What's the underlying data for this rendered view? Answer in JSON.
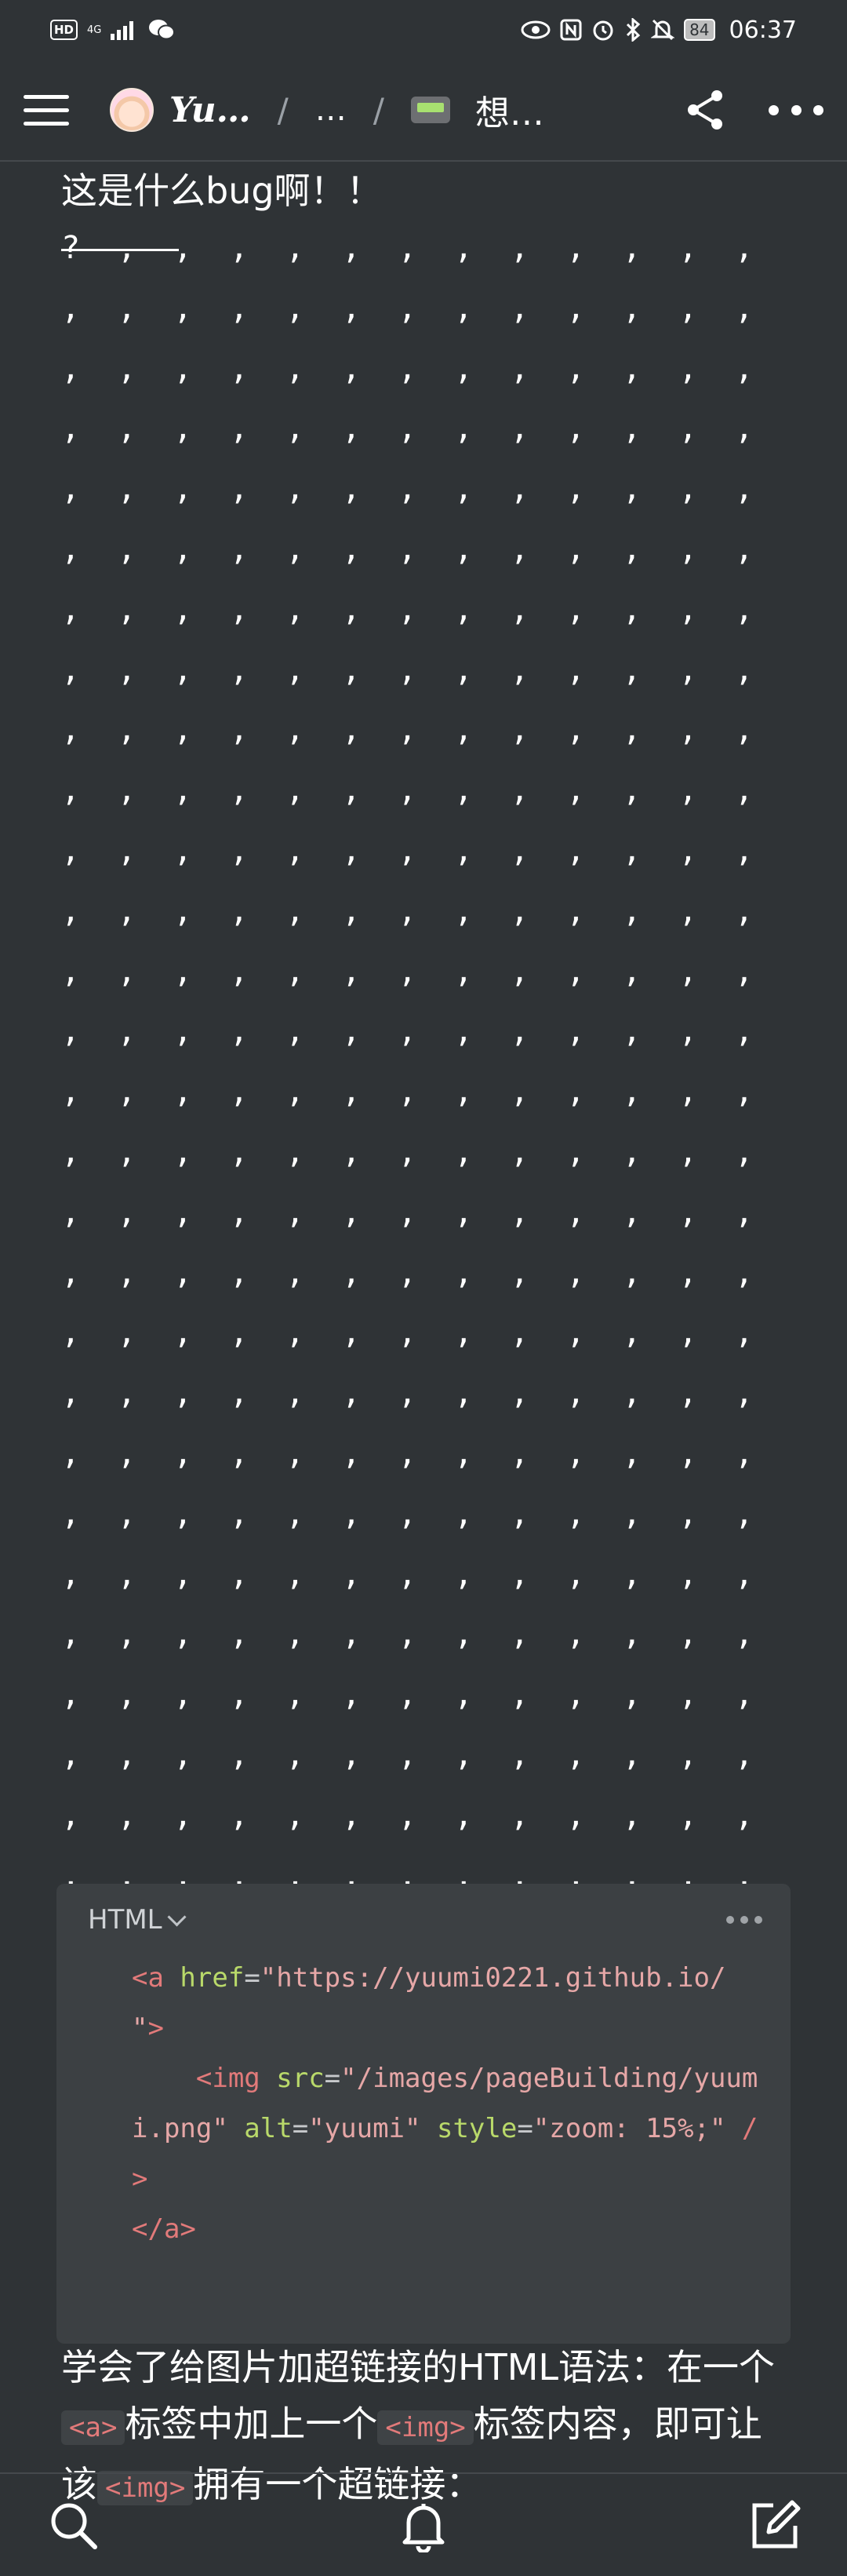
{
  "status_bar": {
    "hd_label": "HD",
    "network_label": "4G",
    "battery": "84",
    "time": "06:37",
    "icons": [
      "hd-icon",
      "signal-icon",
      "wechat-icon",
      "eye-icon",
      "nfc-icon",
      "alarm-icon",
      "bluetooth-icon",
      "mute-icon",
      "battery-icon"
    ]
  },
  "header": {
    "title": "Yu…",
    "middle": "…",
    "page_title": "想…",
    "separator": "/"
  },
  "content": {
    "heading": "这是什么bug啊！！",
    "dots_text": "? , , , , , , , , , , , , , , , , , , , , , , , , , , , , , , , , , , , , , , , , , , , , , , , , , , , , , , , , , , , , , , , , , , , , , , , , , , , , , , , , , , , , , , , , , , , , , , , , , , , , , , , , , , , , , , , , , , , , , , , , , , , , , , , , , , , , , , , , , , , , , , , , , , , , , , , , , , , , , , , , , , , , , , , , , , , , , , , , , , , , , , , , , , , , , , , , , , , , , , , , , , , , , , , , , , , , , , , , , , , , , , , , , , , , , , , , , , , , , , , , , , , , , , , , , , , , , , , , , , , , , , , , , , , , , , , , , , , , , , , , , , , , , , , , , , , , , , , , , , , , , , , , , , , , , , , , , , , , , , , , , , , , , , , , , , , , , , , , , , , , , , , , , , , , , , , , , , , , , , , , , , , , , , , , , , , , , , , , , , , , , , , , , , , , , , , , , , , , , , , , , , , , , , , , , , , , , , , , , , , , , , , , , , , , , , , , , , , , , , , , , , , , , , , , , ,",
    "para_part1": "学会了给图片加超链接的HTML语法：在一个",
    "code_a": "<a>",
    "para_part2": "标签中加上一个",
    "code_img": "<img>",
    "para_part3": "标签内容，即可让该",
    "code_img2": "<img>",
    "para_part4": "拥有一个超链接："
  },
  "code_block": {
    "language": "HTML",
    "line1_tag_open": "<a ",
    "line1_attr": "href",
    "line1_eq": "=",
    "line1_str": "\"https://yuumi0221.github.io/ \"",
    "line1_close": ">",
    "line2_indent": "    ",
    "line2_tag": "<img ",
    "line2_attr1": "src",
    "line2_eq1": "=",
    "line2_str1": "\"/images/pageBuilding/yuumi.png\"",
    "line2_attr2": " alt",
    "line2_eq2": "=",
    "line2_str2": "\"yuumi\"",
    "line2_attr3": " style",
    "line2_eq3": "=",
    "line2_str3": "\"zoom: 15%;\"",
    "line2_end": " />",
    "line3": "</a>"
  },
  "bottom_nav": {
    "icons": [
      "search-icon",
      "bell-icon",
      "edit-icon"
    ]
  }
}
